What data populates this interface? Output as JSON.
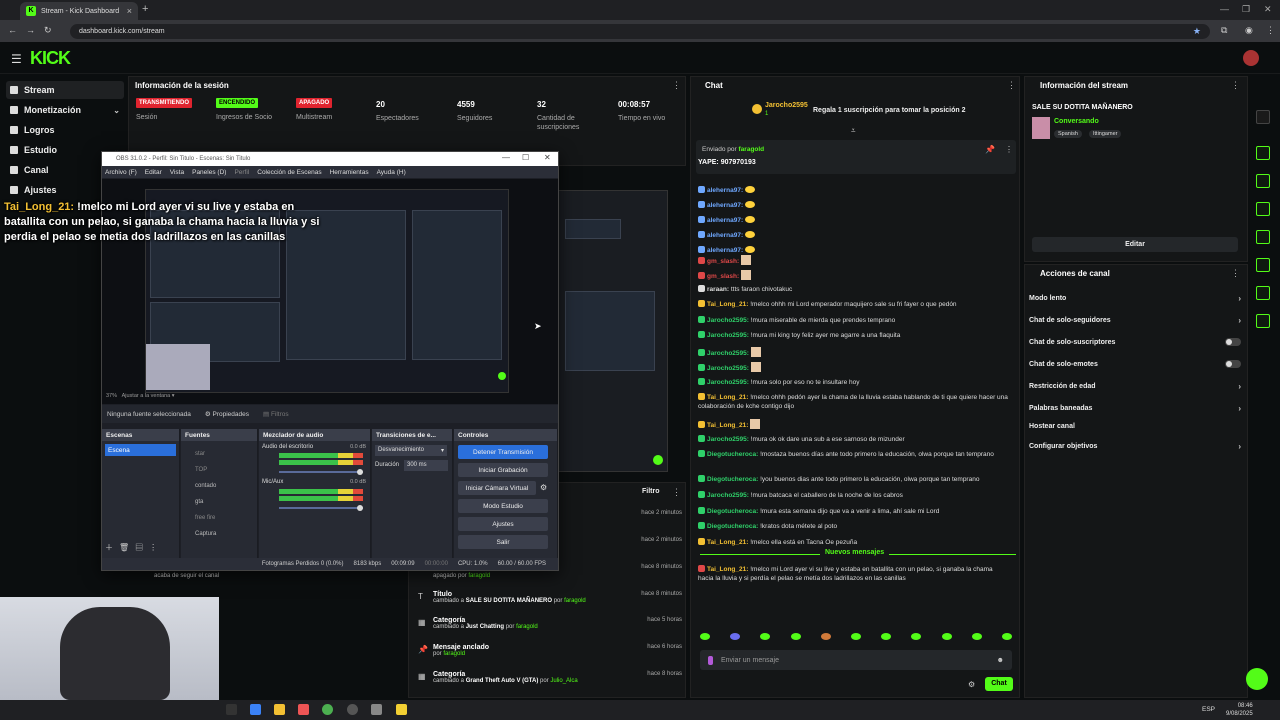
{
  "browser": {
    "tab_title": "Stream - Kick Dashboard",
    "url": "dashboard.kick.com/stream"
  },
  "brand": {
    "logo": "KICK",
    "accent": "#53fc18"
  },
  "sidebar": {
    "items": [
      {
        "label": "Stream"
      },
      {
        "label": "Monetización"
      },
      {
        "label": "Logros"
      },
      {
        "label": "Estudio"
      },
      {
        "label": "Canal"
      },
      {
        "label": "Ajustes"
      }
    ]
  },
  "session": {
    "title": "Información de la sesión",
    "stats": [
      {
        "badge": "TRANSMITIENDO",
        "label": "Sesión"
      },
      {
        "badge": "ENCENDIDO",
        "label": "Ingresos de Socio"
      },
      {
        "badge": "APAGADO",
        "label": "Multistream"
      },
      {
        "value": "20",
        "label": "Espectadores"
      },
      {
        "value": "4559",
        "label": "Seguidores"
      },
      {
        "value": "32",
        "label": "Cantidad de suscripciones"
      },
      {
        "value": "00:08:57",
        "label": "Tiempo en vivo"
      }
    ]
  },
  "overlay": {
    "user": "Tai_Long_21:",
    "text": "!melco mi Lord ayer vi su live y estaba en batallita con un pelao, si ganaba la chama hacia la lluvia y si perdia el pelao se metia dos ladrillazos en las canillas"
  },
  "obs": {
    "title": "OBS 31.0.2 - Perfil: Sin Titulo - Escenas: Sin Titulo",
    "menu": [
      "Archivo (F)",
      "Editar",
      "Vista",
      "Paneles (D)",
      "Perfil",
      "Colección de Escenas",
      "Herramientas",
      "Ayuda (H)"
    ],
    "zoom": "37%",
    "fit": "Ajustar a la ventana",
    "no_source": "Ninguna fuente seleccionada",
    "properties": "Propiedades",
    "filters": "Filtros",
    "docks": {
      "scenes": "Escenas",
      "sources": "Fuentes",
      "mixer": "Mezclador de audio",
      "transitions": "Transiciones de e...",
      "controls": "Controles"
    },
    "scene": "Escena",
    "sources": [
      "star",
      "TOP",
      "contado",
      "gta",
      "free fire",
      "Captura"
    ],
    "mixer": [
      {
        "name": "Audio del escritorio",
        "db": "0.0 dB"
      },
      {
        "name": "Mic/Aux",
        "db": "0.0 dB"
      }
    ],
    "transition": "Desvanecimiento",
    "duration_label": "Duración",
    "duration": "300 ms",
    "controls": [
      "Detener Transmisión",
      "Iniciar Grabación",
      "Iniciar Cámara Virtual",
      "Modo Estudio",
      "Ajustes",
      "Salir"
    ],
    "status": {
      "dropped": "Fotogramas Perdidos 0 (0.0%)",
      "kbps": "8183 kbps",
      "live": "00:09:09",
      "rec": "00:00:00",
      "cpu": "CPU: 1.0%",
      "fps": "60.00 / 60.00 FPS"
    }
  },
  "activity": {
    "filter": "Filtro",
    "rows": [
      {
        "title": "",
        "sub": "",
        "time": "hace 2 minutos"
      },
      {
        "title": "",
        "sub": "",
        "time": "hace 2 minutos"
      },
      {
        "title": "",
        "sub": "",
        "time": "hace 8 minutos"
      },
      {
        "title": "",
        "sub_pre": "apagado por",
        "sub_user": "faragold",
        "time": ""
      },
      {
        "title": "Título",
        "sub_pre": "cambiado a",
        "sub_val": "SALE SU DOTITA MAÑANERO",
        "sub_mid": "por",
        "sub_user": "faragold",
        "time": "hace 8 minutos"
      },
      {
        "title": "Categoría",
        "sub_pre": "cambiado a",
        "sub_val": "Just Chatting",
        "sub_mid": "por",
        "sub_user": "faragold",
        "time": "hace 5 horas"
      },
      {
        "title": "Mensaje anclado",
        "sub_pre": "por",
        "sub_user": "faragold",
        "time": "hace 6 horas"
      },
      {
        "title": "Categoría",
        "sub_pre": "cambiado a",
        "sub_val": "Grand Theft Auto V (GTA)",
        "sub_mid": "por",
        "sub_user": "Julio_Alca",
        "time": "hace 8 horas"
      }
    ],
    "follow_note": "acaba de seguir el canal"
  },
  "chat": {
    "title": "Chat",
    "top_user": "Jarocho2595",
    "top_count": "1",
    "top_action": "Regala 1 suscripción para tomar la posición 2",
    "pinned_by_label": "Enviado por",
    "pinned_by": "faragold",
    "pinned_text": "YAPE: 907970193",
    "messages": [
      {
        "user": "aleherna97:",
        "color": "#6fa8ff",
        "text": "",
        "emote": true
      },
      {
        "user": "aleherna97:",
        "color": "#6fa8ff",
        "text": "",
        "emote": true
      },
      {
        "user": "aleherna97:",
        "color": "#6fa8ff",
        "text": "",
        "emote": true
      },
      {
        "user": "aleherna97:",
        "color": "#6fa8ff",
        "text": "",
        "emote": true
      },
      {
        "user": "aleherna97:",
        "color": "#6fa8ff",
        "text": "",
        "emote": true
      },
      {
        "user": "gm_slash:",
        "color": "#e04848",
        "text": "",
        "emote2": true
      },
      {
        "user": "gm_slash:",
        "color": "#e04848",
        "text": "",
        "emote2": true
      },
      {
        "user": "raraan:",
        "color": "#dddddd",
        "text": "ttts faraon chivotakuc"
      },
      {
        "user": "Tai_Long_21:",
        "color": "#f3c033",
        "text": "!melco ohhh mi Lord emperador maquijero sale su fri fayer o que pedón"
      },
      {
        "user": "Jarocho2595:",
        "color": "#2fd16a",
        "text": "!mura miserable de mierda que prendes temprano"
      },
      {
        "user": "Jarocho2595:",
        "color": "#2fd16a",
        "text": "!mura mi king toy feliz ayer me agarre a una flaquita"
      },
      {
        "user": "Jarocho2595:",
        "color": "#2fd16a",
        "text": "",
        "emote2": true
      },
      {
        "user": "Jarocho2595:",
        "color": "#2fd16a",
        "text": "",
        "emote2": true
      },
      {
        "user": "Jarocho2595:",
        "color": "#2fd16a",
        "text": "!mura solo por eso no te insultare hoy"
      },
      {
        "user": "Tai_Long_21:",
        "color": "#f3c033",
        "text": "!melco ohhh pedón ayer la chama de la lluvia estaba hablando de ti que quiere hacer una colaboración de kche contigo dijo",
        "wrap": true
      },
      {
        "user": "Tai_Long_21:",
        "color": "#f3c033",
        "text": "",
        "emote2": true
      },
      {
        "user": "Jarocho2595:",
        "color": "#2fd16a",
        "text": "!mura ok ok dare una sub a ese sarnoso de mizunder"
      },
      {
        "user": "Diegotucheroca:",
        "color": "#2fd16a",
        "text": "!mostaza buenos días ante todo primero la educación, olwa porque tan temprano",
        "wrap": true
      },
      {
        "user": "Diegotucheroca:",
        "color": "#2fd16a",
        "text": "!you buenos dias ante todo primero la educación, olwa porque tan temprano"
      },
      {
        "user": "Jarocho2595:",
        "color": "#2fd16a",
        "text": "!mura batcaca el caballero de la noche de los cabros"
      },
      {
        "user": "Diegotucheroca:",
        "color": "#2fd16a",
        "text": "!mura esta semana dijo que va a venir a lima, ahí sale mi Lord"
      },
      {
        "user": "Diegotucheroca:",
        "color": "#2fd16a",
        "text": "!kratos dota métete al poto"
      },
      {
        "user": "Tai_Long_21:",
        "color": "#f3c033",
        "text": "!melco ella está en Tacna Oe pezuña"
      }
    ],
    "new_messages": "Nuevos mensajes",
    "last_user": "Tai_Long_21:",
    "last_text": "!melco mi Lord ayer vi su live y estaba en batallita con un pelao, si ganaba la chama hacia la lluvia y si perdía el pelao se metía dos ladrillazos en las canillas",
    "input_placeholder": "Enviar un mensaje",
    "send": "Chat"
  },
  "stream_info": {
    "title": "Información del stream",
    "stream_title": "SALE SU DOTITA MAÑANERO",
    "category": "Conversando",
    "tags": [
      "Spanish",
      "Ittingamer"
    ],
    "edit": "Editar"
  },
  "channel_actions": {
    "title": "Acciones de canal",
    "items": [
      {
        "label": "Modo lento",
        "kind": "chev"
      },
      {
        "label": "Chat de solo-seguidores",
        "kind": "chev"
      },
      {
        "label": "Chat de solo-suscriptores",
        "kind": "toggle"
      },
      {
        "label": "Chat de solo-emotes",
        "kind": "toggle"
      },
      {
        "label": "Restricción de edad",
        "kind": "chev"
      },
      {
        "label": "Palabras baneadas",
        "kind": "chev"
      },
      {
        "label": "Hostear canal",
        "kind": "none"
      },
      {
        "label": "Configurar objetivos",
        "kind": "chev"
      }
    ]
  },
  "taskbar": {
    "time": "08:46",
    "date": "9/08/2025",
    "lang": "ESP"
  }
}
